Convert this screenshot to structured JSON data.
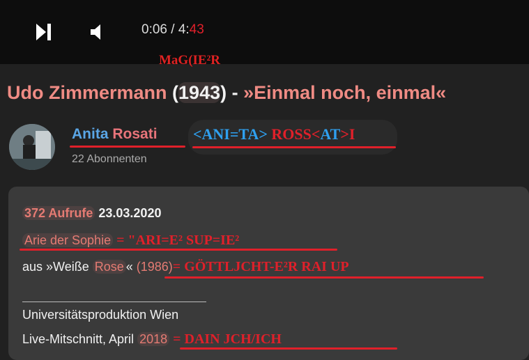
{
  "player": {
    "time_current": "0:06",
    "time_sep": " / 4:",
    "time_total_tail": "43",
    "header_note": "MaG(IE²R"
  },
  "video": {
    "title_parts": [
      "Udo Zimmermann",
      " (",
      "1943",
      ") - ",
      "»Einmal noch, einmal«"
    ]
  },
  "channel": {
    "name_first": "Anita",
    "name_last": "Rosati",
    "subscribers": "22 Abonnenten",
    "annotation_parts": [
      "<ANI=TA>",
      " ROSS<",
      "AT",
      ">I"
    ]
  },
  "description": {
    "views": "372 Aufrufe",
    "date": "23.03.2020",
    "line2": "Arie der Sophie",
    "line2_ann": "= \"ARI=E²  SUP=IE²",
    "line3_pre": "aus »Weiße ",
    "line3_rose": "Rose",
    "line3_post": "« ",
    "line3_year": "(1986)",
    "line3_ann": "= GÖTTLJCHT-E²R RAI   UP",
    "line4": "Universitätsproduktion Wien",
    "line5_pre": "Live-Mitschnitt, April ",
    "line5_year": "2018",
    "line5_ann": " = DAIN JCH/ICH"
  },
  "colors": {
    "annotation_red": "#e0202a",
    "annotation_blue": "#2fa0ef",
    "title_pink": "#ef8b84",
    "link_blue": "#5aa6e6"
  },
  "icons": [
    "skip-next-icon",
    "volume-icon"
  ]
}
